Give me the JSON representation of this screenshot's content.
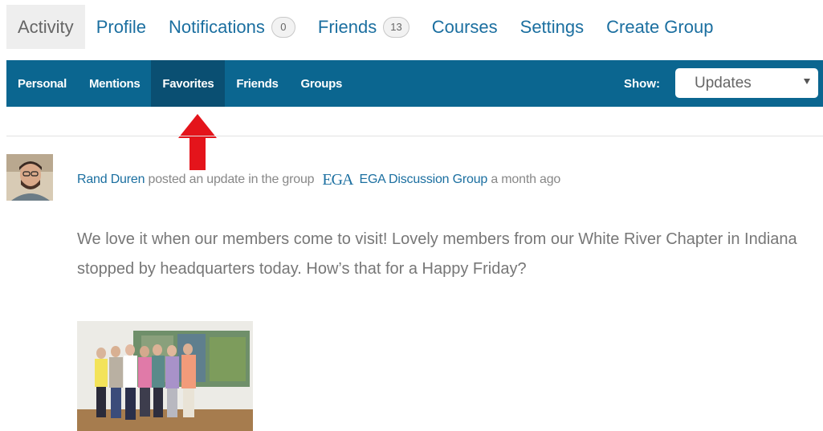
{
  "top_nav": {
    "tabs": [
      {
        "label": "Activity"
      },
      {
        "label": "Profile"
      },
      {
        "label": "Notifications",
        "count": "0"
      },
      {
        "label": "Friends",
        "count": "13"
      },
      {
        "label": "Courses"
      },
      {
        "label": "Settings"
      },
      {
        "label": "Create Group"
      }
    ],
    "active": "Activity"
  },
  "sub_nav": {
    "tabs": [
      {
        "label": "Personal"
      },
      {
        "label": "Mentions"
      },
      {
        "label": "Favorites"
      },
      {
        "label": "Friends"
      },
      {
        "label": "Groups"
      }
    ],
    "active": "Favorites",
    "show_label": "Show:",
    "show_value": "Updates",
    "accent_color": "#0b6690"
  },
  "annotation": {
    "icon": "red-up-arrow-icon",
    "color": "#e4141b"
  },
  "activity": {
    "author": "Rand Duren",
    "action": "posted an update in the group",
    "group_logo_text": "EGA",
    "group_name": "EGA Discussion Group",
    "time": "a month ago",
    "text": "We love it when our members come to visit! Lovely members from our White River Chapter in Indiana stopped by headquarters today. How’s that for a Happy Friday?"
  }
}
